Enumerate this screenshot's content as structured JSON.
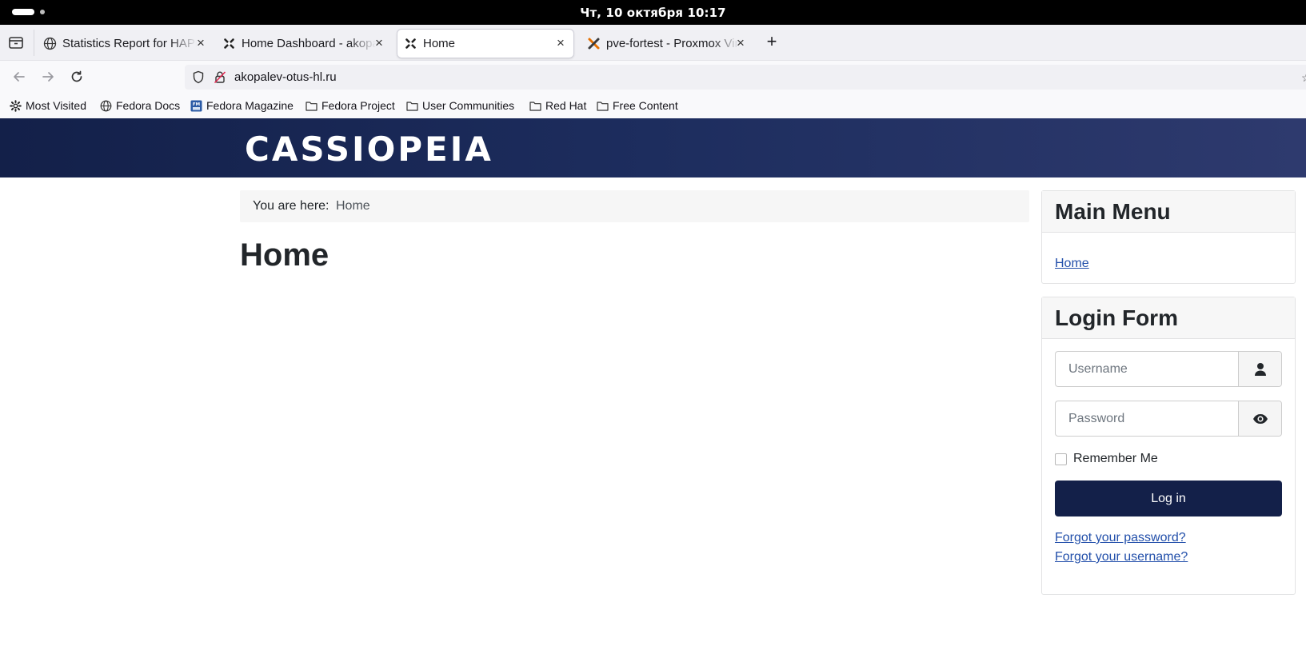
{
  "system": {
    "clock": "Чт, 10 октября  10:17"
  },
  "browser": {
    "tabs": [
      {
        "title": "Statistics Report for HAProxy",
        "favicon": "globe-icon"
      },
      {
        "title": "Home Dashboard - akopalev",
        "favicon": "joomla-icon"
      },
      {
        "title": "Home",
        "favicon": "joomla-icon",
        "active": true
      },
      {
        "title": "pve-fortest - Proxmox Virtual",
        "favicon": "proxmox-icon"
      }
    ],
    "url": "akopalev-otus-hl.ru",
    "bookmarks": [
      {
        "label": "Most Visited",
        "icon": "gear-icon"
      },
      {
        "label": "Fedora Docs",
        "icon": "globe-icon"
      },
      {
        "label": "Fedora Magazine",
        "icon": "fedora-magazine-icon"
      },
      {
        "label": "Fedora Project",
        "icon": "folder-icon"
      },
      {
        "label": "User Communities",
        "icon": "folder-icon"
      },
      {
        "label": "Red Hat",
        "icon": "folder-icon"
      },
      {
        "label": "Free Content",
        "icon": "folder-icon"
      }
    ]
  },
  "site": {
    "brand": "CASSIOPEIA",
    "brand_color": "#132049",
    "breadcrumb": {
      "label": "You are here:",
      "current": "Home"
    },
    "page_title": "Home"
  },
  "sidebar": {
    "main_menu": {
      "title": "Main Menu",
      "items": [
        "Home"
      ]
    },
    "login": {
      "title": "Login Form",
      "username_placeholder": "Username",
      "password_placeholder": "Password",
      "remember_label": "Remember Me",
      "submit_label": "Log in",
      "forgot_password": "Forgot your password?",
      "forgot_username": "Forgot your username?"
    }
  }
}
